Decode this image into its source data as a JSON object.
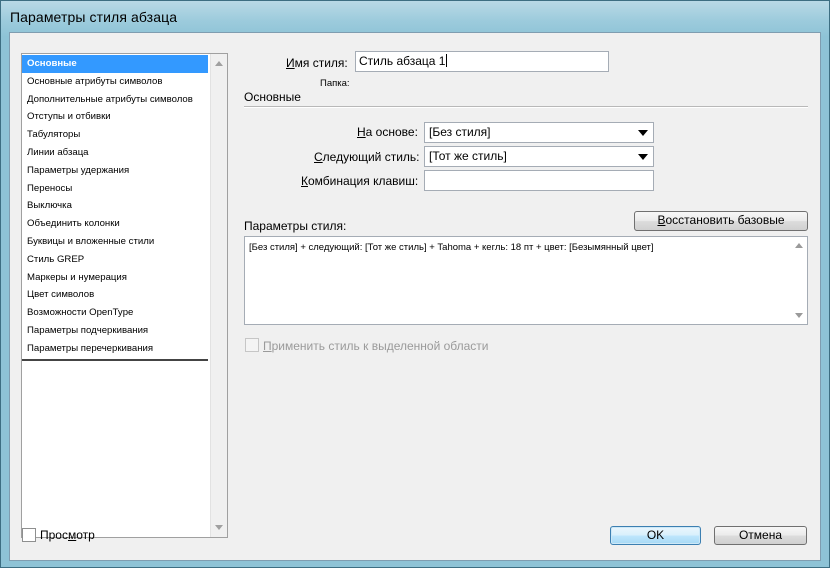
{
  "window": {
    "title": "Параметры стиля абзаца"
  },
  "nav": {
    "items": [
      "Основные",
      "Основные атрибуты символов",
      "Дополнительные атрибуты символов",
      "Отступы и отбивки",
      "Табуляторы",
      "Линии абзаца",
      "Параметры удержания",
      "Переносы",
      "Выключка",
      "Объединить колонки",
      "Буквицы и вложенные стили",
      "Стиль GREP",
      "Маркеры и нумерация",
      "Цвет символов",
      "Возможности OpenType",
      "Параметры подчеркивания",
      "Параметры перечеркивания"
    ],
    "selected_index": 0
  },
  "form": {
    "style_name_label_u": "И",
    "style_name_label_rest": "мя стиля:",
    "style_name_value": "Стиль абзаца 1",
    "folder_label": "Папка:",
    "section_title": "Основные",
    "based_on_label_u": "Н",
    "based_on_label_rest": "а основе:",
    "based_on_value": "[Без стиля]",
    "next_style_label_u": "С",
    "next_style_label_rest": "ледующий стиль:",
    "next_style_value": "[Тот же стиль]",
    "shortcut_label_u": "К",
    "shortcut_label_rest": "омбинация клавиш:",
    "shortcut_value": "",
    "style_settings_label": "Параметры стиля:",
    "reset_button_u": "В",
    "reset_button_rest": "осстановить базовые",
    "style_settings_text": "[Без стиля] + следующий: [Тот же стиль] + Tahoma + кегль: 18 пт + цвет: [Безымянный цвет]",
    "apply_label_u": "П",
    "apply_label_rest": "рименить стиль к выделенной области",
    "apply_checked": false
  },
  "footer": {
    "preview_label_a": "Прос",
    "preview_label_u": "м",
    "preview_label_b": "отр",
    "preview_checked": false,
    "ok_label": "OK",
    "cancel_label": "Отмена"
  },
  "colors": {
    "selection": "#3399ff",
    "titlebar": "#9ccbdc",
    "dialog_bg": "#f0f0f0"
  }
}
